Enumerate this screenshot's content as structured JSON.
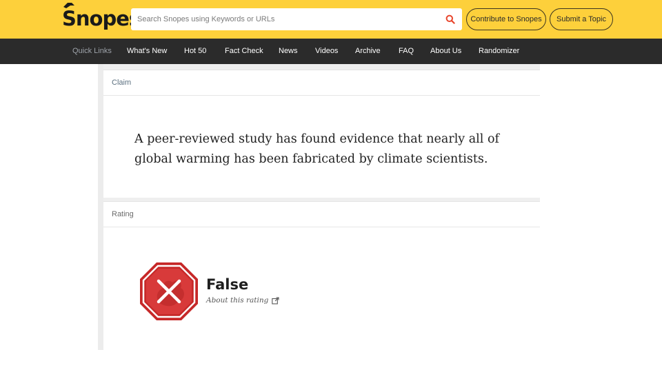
{
  "header": {
    "logo_text": "Snopes",
    "search": {
      "placeholder": "Search Snopes using Keywords or URLs"
    },
    "contribute_label": "Contribute to Snopes",
    "submit_label": "Submit a Topic",
    "brand_color": "#fdd03b"
  },
  "nav": {
    "items": [
      {
        "label": "Quick Links"
      },
      {
        "label": "What's New"
      },
      {
        "label": "Hot 50"
      },
      {
        "label": "Fact Check"
      },
      {
        "label": "News"
      },
      {
        "label": "Videos"
      },
      {
        "label": "Archive"
      },
      {
        "label": "FAQ"
      },
      {
        "label": "About Us"
      },
      {
        "label": "Randomizer"
      }
    ]
  },
  "claim": {
    "heading": "Claim",
    "text": "A peer-reviewed study has found evidence that nearly all of global warming has been fabricated by climate scientists."
  },
  "rating": {
    "heading": "Rating",
    "value": "False",
    "link_text": "About this rating",
    "badge_icon": "false-stop-sign-icon",
    "badge_color": "#d32f2f"
  }
}
